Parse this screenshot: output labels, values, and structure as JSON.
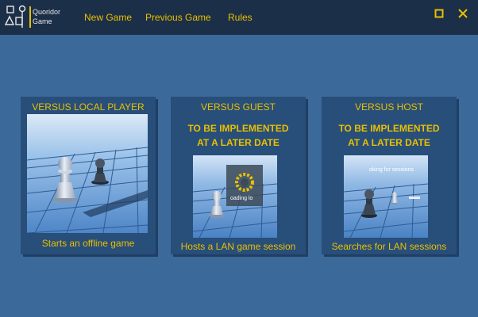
{
  "app": {
    "logo_line1": "Quoridor",
    "logo_line2": "Game"
  },
  "menu": {
    "items": [
      {
        "label": "New Game"
      },
      {
        "label": "Previous Game"
      },
      {
        "label": "Rules"
      }
    ]
  },
  "window_controls": {
    "maximize_icon": "maximize-icon",
    "close_icon": "close-icon"
  },
  "cards": [
    {
      "title": "VERSUS LOCAL PLAYER",
      "todo_line1": "",
      "todo_line2": "",
      "caption": "Starts an offline game"
    },
    {
      "title": "VERSUS GUEST",
      "todo_line1": "TO BE IMPLEMENTED",
      "todo_line2": "AT A LATER DATE",
      "caption": "Hosts a LAN game session",
      "overlay_text": "oading lo"
    },
    {
      "title": "VERSUS HOST",
      "todo_line1": "TO BE IMPLEMENTED",
      "todo_line2": "AT A LATER DATE",
      "caption": "Searches for LAN sessions",
      "overlay_text": "oking for sessions"
    }
  ],
  "colors": {
    "accent": "#e8c000",
    "background": "#3b6a9a",
    "titlebar": "#1c2f48",
    "card": "#284e7a"
  }
}
